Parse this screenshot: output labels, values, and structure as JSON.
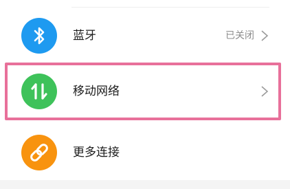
{
  "settings": {
    "items": [
      {
        "label": "蓝牙",
        "status": "已关闭",
        "icon": "bluetooth-icon",
        "icon_color": "#1e9af0",
        "has_chevron": true
      },
      {
        "label": "移动网络",
        "status": "",
        "icon": "mobile-data-arrows-icon",
        "icon_color": "#3ec25a",
        "has_chevron": true
      },
      {
        "label": "更多连接",
        "status": "",
        "icon": "link-icon",
        "icon_color": "#f8930f",
        "has_chevron": false
      }
    ]
  },
  "highlight": {
    "target": "移动网络",
    "color": "#e8709a"
  }
}
